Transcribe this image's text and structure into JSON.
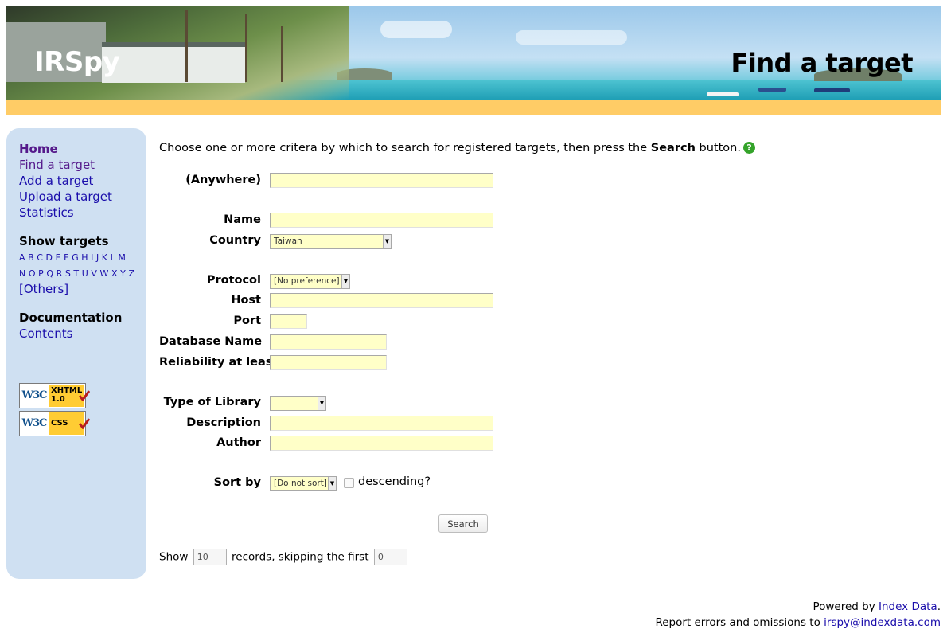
{
  "header": {
    "site_title": "IRSpy",
    "page_title": "Find a target"
  },
  "sidebar": {
    "nav": [
      "Home",
      "Find a target",
      "Add a target",
      "Upload a target",
      "Statistics"
    ],
    "show_targets_heading": "Show targets",
    "letters_row1": [
      "A",
      "B",
      "C",
      "D",
      "E",
      "F",
      "G",
      "H",
      "I",
      "J",
      "K",
      "L",
      "M"
    ],
    "letters_row2": [
      "N",
      "O",
      "P",
      "Q",
      "R",
      "S",
      "T",
      "U",
      "V",
      "W",
      "X",
      "Y",
      "Z"
    ],
    "others_link": "[Others]",
    "documentation_heading": "Documentation",
    "contents_link": "Contents",
    "badges": [
      {
        "w3c": "W3C",
        "label1": "XHTML",
        "label2": "1.0"
      },
      {
        "w3c": "W3C",
        "label1": "CSS",
        "label2": ""
      }
    ]
  },
  "intro": {
    "before": "Choose one or more critera by which to search for registered targets, then press the ",
    "bold": "Search",
    "after": " button.",
    "help_icon": "?"
  },
  "form": {
    "anywhere_label": "(Anywhere)",
    "name_label": "Name",
    "country_label": "Country",
    "country_value": "Taiwan",
    "protocol_label": "Protocol",
    "protocol_value": "[No preference]",
    "host_label": "Host",
    "port_label": "Port",
    "database_name_label": "Database Name",
    "reliability_label": "Reliability at least",
    "type_of_library_label": "Type of Library",
    "type_of_library_value": "",
    "description_label": "Description",
    "author_label": "Author",
    "sort_by_label": "Sort by",
    "sort_by_value": "[Do not sort]",
    "descending_label": "descending?",
    "search_button": "Search"
  },
  "paging": {
    "show_label": "Show",
    "records_value": "10",
    "skipping_label": "records, skipping the first",
    "skip_value": "0"
  },
  "footer": {
    "powered_by": "Powered by ",
    "powered_link": "Index Data",
    "powered_end": ".",
    "report": "Report errors and omissions to ",
    "report_link": "irspy@indexdata.com"
  }
}
